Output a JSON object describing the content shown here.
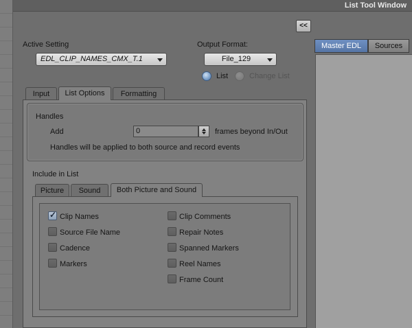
{
  "window": {
    "title": "List Tool Window",
    "collapse_label": "<<"
  },
  "active_setting": {
    "label": "Active Setting",
    "value": "EDL_CLIP_NAMES_CMX_T.1"
  },
  "output_format": {
    "label": "Output Format:",
    "value": "File_129"
  },
  "output_mode": {
    "options": [
      {
        "label": "List",
        "selected": true
      },
      {
        "label": "Change List",
        "selected": false
      }
    ]
  },
  "main_tabs": [
    "Input",
    "List Options",
    "Formatting"
  ],
  "main_active_tab": "List Options",
  "handles": {
    "group_label": "Handles",
    "add_label": "Add",
    "value": "0",
    "suffix": "frames beyond In/Out",
    "note": "Handles will be applied to both source and record events"
  },
  "include": {
    "label": "Include in List",
    "tabs": [
      "Picture",
      "Sound",
      "Both Picture and Sound"
    ],
    "active_tab": "Both Picture and Sound",
    "left_options": [
      {
        "label": "Clip Names",
        "checked": true
      },
      {
        "label": "Source File Name",
        "checked": false
      },
      {
        "label": "Cadence",
        "checked": false
      },
      {
        "label": "Markers",
        "checked": false
      }
    ],
    "right_options": [
      {
        "label": "Clip Comments",
        "checked": false
      },
      {
        "label": "Repair Notes",
        "checked": false
      },
      {
        "label": "Spanned Markers",
        "checked": false
      },
      {
        "label": "Reel Names",
        "checked": false
      },
      {
        "label": "Frame Count",
        "checked": false
      }
    ]
  },
  "right_tabs": [
    "Master EDL",
    "Sources"
  ],
  "right_active_tab": "Master EDL",
  "colors": {
    "accent": "#5f7fb0",
    "panel": "#828282",
    "background": "#6e6e6e"
  }
}
